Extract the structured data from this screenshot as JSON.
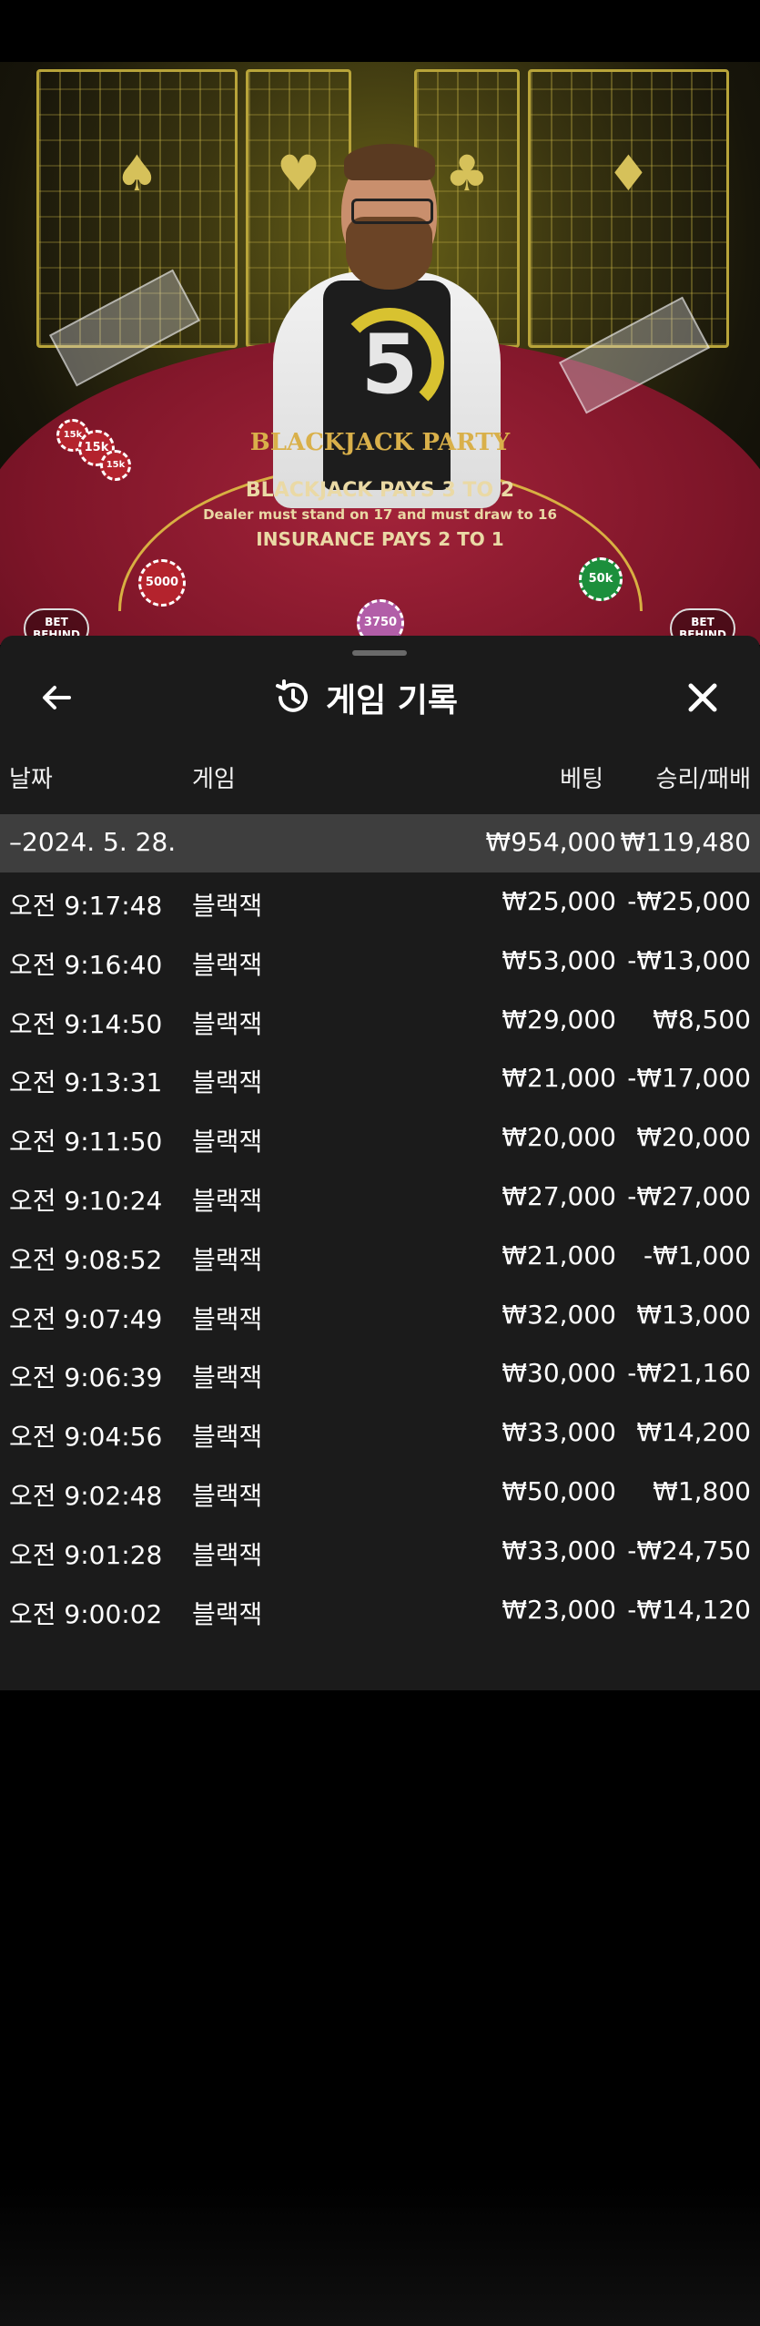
{
  "game_view": {
    "timer": "5",
    "table_logo": "BLACKJACK PARTY",
    "felt_lines": [
      "BLACKJACK PAYS 3 TO 2",
      "Dealer must stand on 17 and must draw to 16",
      "INSURANCE PAYS 2 TO 1"
    ],
    "chips": [
      "15k",
      "15k",
      "15k",
      "5000",
      "3750",
      "50k"
    ],
    "seats": [
      {
        "label": "BET\nBEHIND"
      },
      {
        "label": "BET\nBEHIND"
      }
    ]
  },
  "sheet": {
    "title": "게임 기록",
    "columns": {
      "date": "날짜",
      "game": "게임",
      "bet": "베팅",
      "win_loss": "승리/패배"
    },
    "summary": {
      "date": "–2024. 5. 28.",
      "bet": "₩954,000",
      "win_loss": "₩119,480"
    },
    "rows": [
      {
        "time": "오전 9:17:48",
        "game": "블랙잭",
        "bet": "₩25,000",
        "result": "-₩25,000"
      },
      {
        "time": "오전 9:16:40",
        "game": "블랙잭",
        "bet": "₩53,000",
        "result": "-₩13,000"
      },
      {
        "time": "오전 9:14:50",
        "game": "블랙잭",
        "bet": "₩29,000",
        "result": "₩8,500"
      },
      {
        "time": "오전 9:13:31",
        "game": "블랙잭",
        "bet": "₩21,000",
        "result": "-₩17,000"
      },
      {
        "time": "오전 9:11:50",
        "game": "블랙잭",
        "bet": "₩20,000",
        "result": "₩20,000"
      },
      {
        "time": "오전 9:10:24",
        "game": "블랙잭",
        "bet": "₩27,000",
        "result": "-₩27,000"
      },
      {
        "time": "오전 9:08:52",
        "game": "블랙잭",
        "bet": "₩21,000",
        "result": "-₩1,000"
      },
      {
        "time": "오전 9:07:49",
        "game": "블랙잭",
        "bet": "₩32,000",
        "result": "₩13,000"
      },
      {
        "time": "오전 9:06:39",
        "game": "블랙잭",
        "bet": "₩30,000",
        "result": "-₩21,160"
      },
      {
        "time": "오전 9:04:56",
        "game": "블랙잭",
        "bet": "₩33,000",
        "result": "₩14,200"
      },
      {
        "time": "오전 9:02:48",
        "game": "블랙잭",
        "bet": "₩50,000",
        "result": "₩1,800"
      },
      {
        "time": "오전 9:01:28",
        "game": "블랙잭",
        "bet": "₩33,000",
        "result": "-₩24,750"
      },
      {
        "time": "오전 9:00:02",
        "game": "블랙잭",
        "bet": "₩23,000",
        "result": "-₩14,120"
      }
    ]
  }
}
